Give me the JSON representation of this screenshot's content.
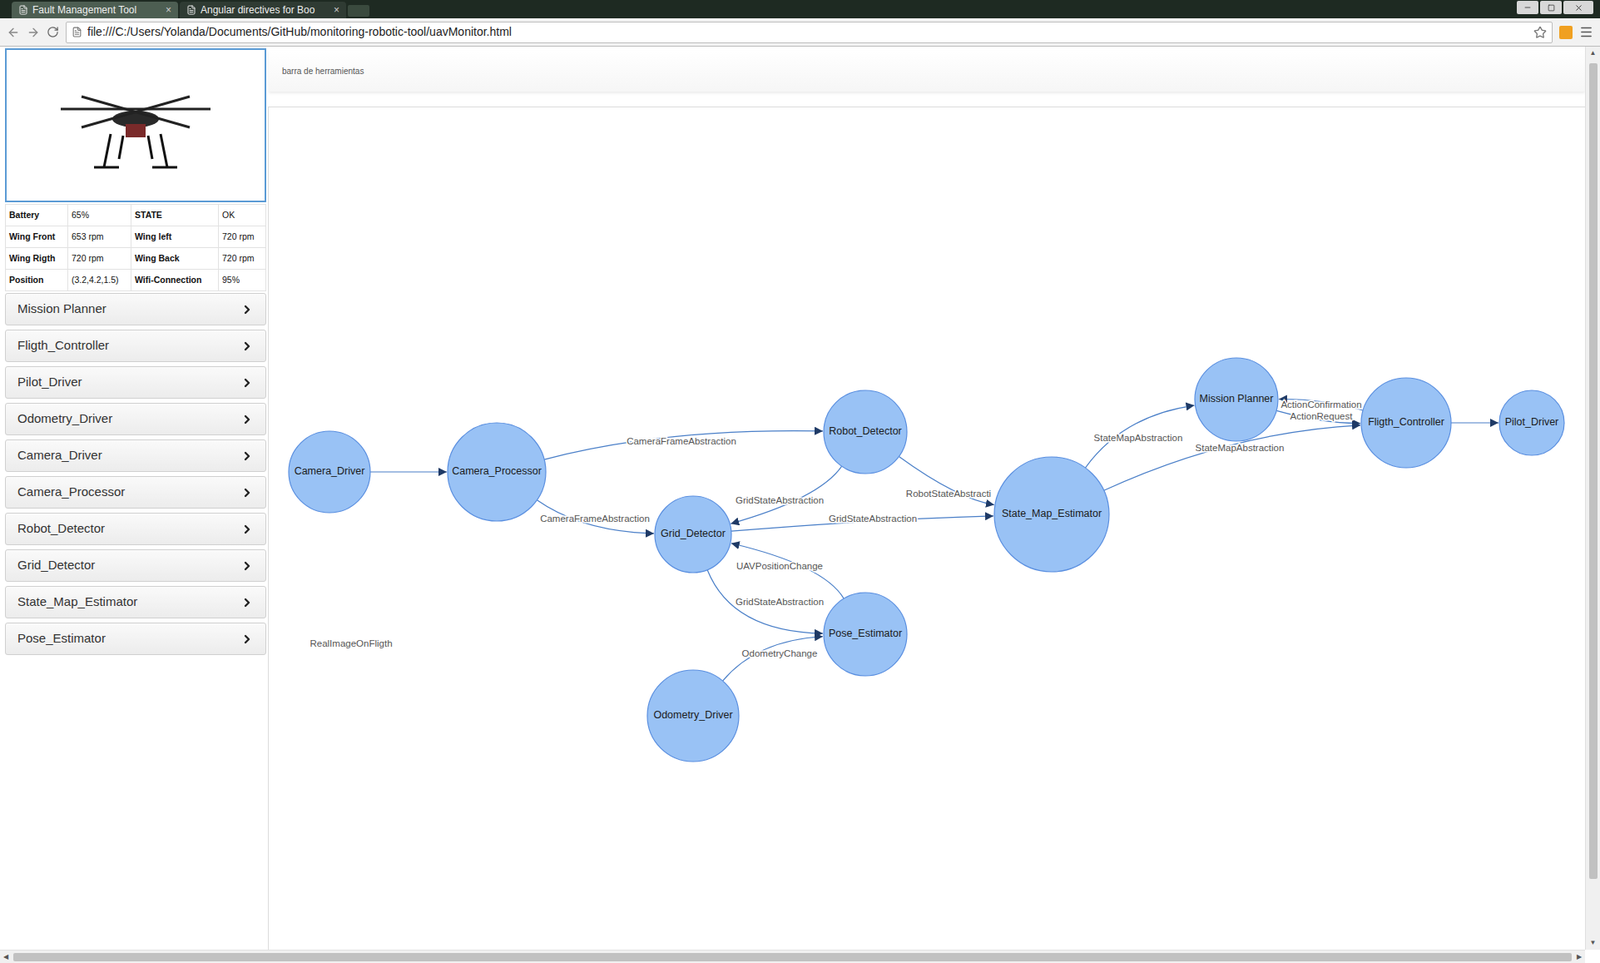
{
  "browser": {
    "tabs": [
      {
        "label": "Fault Management Tool",
        "selected": true,
        "close": "×"
      },
      {
        "label": "Angular directives for Boo",
        "selected": false,
        "close": "×"
      }
    ],
    "address": "file:///C:/Users/Yolanda/Documents/GitHub/monitoring-robotic-tool/uavMonitor.html"
  },
  "uav": {
    "status": [
      {
        "cells": [
          "Battery",
          "65%",
          "STATE",
          "OK"
        ]
      },
      {
        "cells": [
          "Wing Front",
          "653 rpm",
          "Wing left",
          "720 rpm"
        ]
      },
      {
        "cells": [
          "Wing Rigth",
          "720 rpm",
          "Wing Back",
          "720 rpm"
        ]
      },
      {
        "cells": [
          "Position",
          "(3.2,4.2,1.5)",
          "Wifi-Connection",
          "95%"
        ]
      }
    ]
  },
  "sidebar": {
    "items": [
      {
        "label": "Mission Planner",
        "expanded": false
      },
      {
        "label": "Fligth_Controller",
        "expanded": false
      },
      {
        "label": "Pilot_Driver",
        "expanded": false
      },
      {
        "label": "Odometry_Driver",
        "expanded": false
      },
      {
        "label": "Camera_Driver",
        "expanded": false
      },
      {
        "label": "Camera_Processor",
        "expanded": false
      },
      {
        "label": "Robot_Detector",
        "expanded": false
      },
      {
        "label": "Grid_Detector",
        "expanded": false
      },
      {
        "label": "State_Map_Estimator",
        "expanded": false
      },
      {
        "label": "Pose_Estimator",
        "expanded": false
      }
    ]
  },
  "toolbar": {
    "label": "barra de herramientas"
  },
  "graph": {
    "nodes": [
      "Camera_Driver",
      "Camera_Processor",
      "Robot_Detector",
      "Grid_Detector",
      "Pose_Estimator",
      "Odometry_Driver",
      "State_Map_Estimator",
      "Mission Planner",
      "Fligth_Controller",
      "Pilot_Driver"
    ],
    "edges": [
      {
        "from": "Camera_Driver",
        "to": "Camera_Processor",
        "label": ""
      },
      {
        "from": "Camera_Processor",
        "to": "Robot_Detector",
        "label": "CameraFrameAbstraction"
      },
      {
        "from": "Camera_Processor",
        "to": "Grid_Detector",
        "label": "CameraFrameAbstraction"
      },
      {
        "from": "Robot_Detector",
        "to": "Grid_Detector",
        "label": "GridStateAbstraction"
      },
      {
        "from": "Robot_Detector",
        "to": "State_Map_Estimator",
        "label": "RobotStateAbstracti"
      },
      {
        "from": "Grid_Detector",
        "to": "State_Map_Estimator",
        "label": "GridStateAbstraction"
      },
      {
        "from": "Pose_Estimator",
        "to": "Grid_Detector",
        "label": "UAVPositionChange"
      },
      {
        "from": "Grid_Detector",
        "to": "Pose_Estimator",
        "label": "GridStateAbstraction"
      },
      {
        "from": "Odometry_Driver",
        "to": "Pose_Estimator",
        "label": "OdometryChange"
      },
      {
        "from": "State_Map_Estimator",
        "to": "Mission Planner",
        "label": "StateMapAbstraction"
      },
      {
        "from": "State_Map_Estimator",
        "to": "Fligth_Controller",
        "label": "StateMapAbstraction"
      },
      {
        "from": "Fligth_Controller",
        "to": "Mission Planner",
        "label": "ActionConfirmation"
      },
      {
        "from": "Mission Planner",
        "to": "Fligth_Controller",
        "label": "ActionRequest"
      },
      {
        "from": "Fligth_Controller",
        "to": "Pilot_Driver",
        "label": ""
      }
    ],
    "floating_labels": [
      "RealImageOnFligth"
    ]
  }
}
